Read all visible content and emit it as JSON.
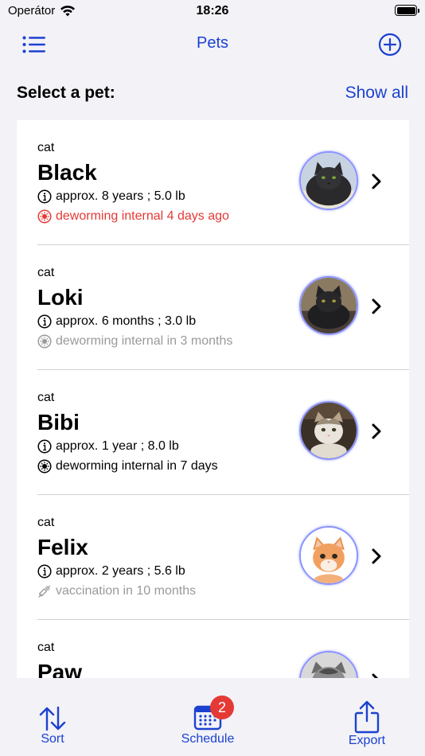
{
  "status_bar": {
    "carrier": "Operátor",
    "time": "18:26"
  },
  "nav": {
    "title": "Pets",
    "left_icon": "list-icon",
    "right_icon": "plus-circle-icon"
  },
  "section": {
    "title": "Select a pet:",
    "action": "Show all"
  },
  "pets": [
    {
      "species": "cat",
      "name": "Black",
      "info": "approx. 8 years ; 5.0 lb",
      "status": "deworming internal 4 days ago",
      "status_kind": "overdue",
      "status_icon": "deworming-icon"
    },
    {
      "species": "cat",
      "name": "Loki",
      "info": "approx. 6 months ; 3.0 lb",
      "status": "deworming internal in 3 months",
      "status_kind": "future",
      "status_icon": "deworming-icon"
    },
    {
      "species": "cat",
      "name": "Bibi",
      "info": "approx. 1 year ; 8.0 lb",
      "status": "deworming internal in 7 days",
      "status_kind": "soon",
      "status_icon": "deworming-icon"
    },
    {
      "species": "cat",
      "name": "Felix",
      "info": "approx. 2 years ; 5.6 lb",
      "status": "vaccination in 10 months",
      "status_kind": "future",
      "status_icon": "syringe-icon"
    },
    {
      "species": "cat",
      "name": "Paw",
      "info": "",
      "status": "",
      "status_kind": "future",
      "status_icon": ""
    }
  ],
  "tabs": {
    "sort": {
      "label": "Sort",
      "icon": "sort-arrows-icon"
    },
    "schedule": {
      "label": "Schedule",
      "icon": "calendar-icon",
      "badge": "2"
    },
    "export": {
      "label": "Export",
      "icon": "share-icon"
    }
  },
  "colors": {
    "accent": "#1c41d1",
    "overdue": "#e53935",
    "muted": "#9a9a9a",
    "badge": "#e53935"
  }
}
